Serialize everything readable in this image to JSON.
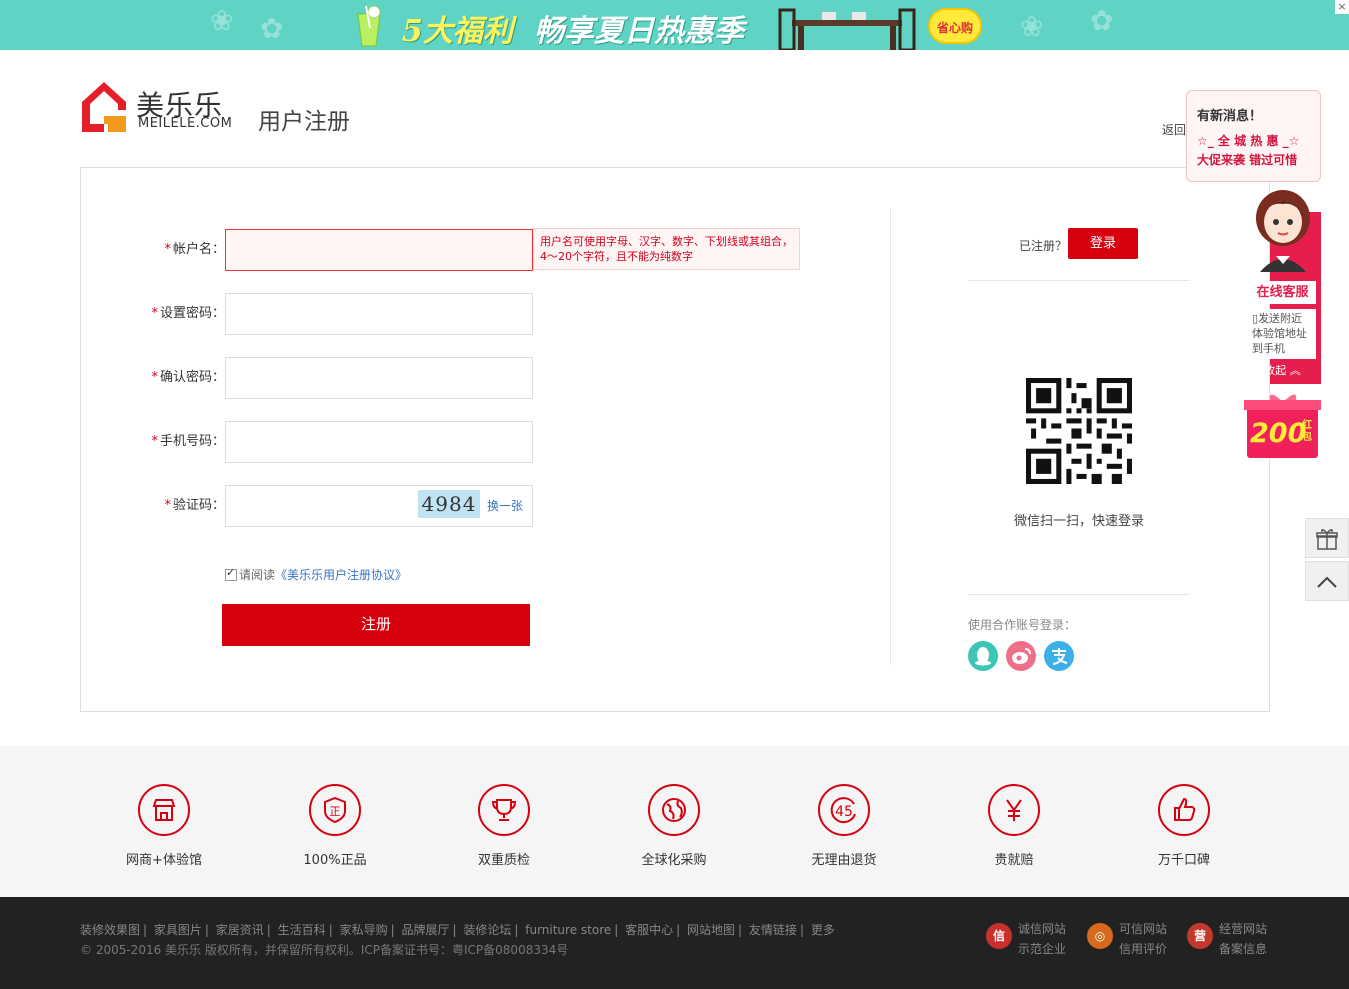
{
  "banner": {
    "title_part1": "5大福利",
    "title_part2": "畅享夏日热惠季",
    "badge": "省心购",
    "close": "×"
  },
  "header": {
    "logo_cn": "美乐乐",
    "logo_en": "MEILELE.COM",
    "page_title": "用户注册",
    "back_link": "返回"
  },
  "notice": {
    "title": "有新消息！",
    "line1": "☆_ 全 城 热 惠 _☆",
    "line2": "大促来袭 错过可惜"
  },
  "form": {
    "fields": [
      {
        "label": "帐户名：",
        "value": "",
        "placeholder": ""
      },
      {
        "label": "设置密码：",
        "value": "",
        "placeholder": ""
      },
      {
        "label": "确认密码：",
        "value": "",
        "placeholder": ""
      },
      {
        "label": "手机号码：",
        "value": "",
        "placeholder": ""
      },
      {
        "label": "验证码：",
        "value": "",
        "placeholder": ""
      }
    ],
    "required_mark": "*",
    "username_hint": "用户名可使用字母、汉字、数字、下划线或其组合，4～20个字符，且不能为纯数字",
    "captcha_text": "4984",
    "captcha_refresh": "换一张",
    "agree_prefix": "请阅读",
    "agree_link": "《美乐乐用户注册协议》",
    "submit": "注册"
  },
  "side": {
    "registered_text": "已注册？",
    "login_button": "登录",
    "qr_caption": "微信扫一扫，快速登录",
    "partner_text": "使用合作账号登录：",
    "partners": [
      {
        "name": "qq-icon",
        "color": "#3cc6b3"
      },
      {
        "name": "weibo-icon",
        "color": "#f0708a"
      },
      {
        "name": "alipay-icon",
        "color": "#3db0e8"
      }
    ]
  },
  "customer_service": {
    "online": "在线客服",
    "send_address": "发送附近体验馆地址到手机",
    "collapse": "收起",
    "redpack_amount": "200",
    "redpack_label": "红包"
  },
  "services": [
    {
      "label": "网商+体验馆",
      "icon": "store-icon"
    },
    {
      "label": "100%正品",
      "icon": "genuine-icon"
    },
    {
      "label": "双重质检",
      "icon": "trophy-icon"
    },
    {
      "label": "全球化采购",
      "icon": "globe-icon"
    },
    {
      "label": "无理由退货",
      "icon": "return-45-icon"
    },
    {
      "label": "贵就赔",
      "icon": "yen-icon"
    },
    {
      "label": "万千口碑",
      "icon": "thumbs-up-icon"
    }
  ],
  "footer": {
    "links": [
      "装修效果图",
      "家具图片",
      "家居资讯",
      "生活百科",
      "家私导购",
      "品牌展厅",
      "装修论坛",
      "furniture store",
      "客服中心",
      "网站地图",
      "友情链接",
      "更多"
    ],
    "copyright": "© 2005-2016 美乐乐 版权所有，并保留所有权利。ICP备案证书号：粤ICP备08008334号",
    "trust": [
      {
        "line1": "诚信网站",
        "line2": "示范企业",
        "icon": "信"
      },
      {
        "line1": "可信网站",
        "line2": "信用评价",
        "icon": "◎"
      },
      {
        "line1": "经营网站",
        "line2": "备案信息",
        "icon": "营"
      }
    ]
  },
  "colors": {
    "accent": "#d7000f",
    "banner": "#5fd3c4",
    "link": "#3a73c8",
    "service_pink": "#e61e4d"
  }
}
